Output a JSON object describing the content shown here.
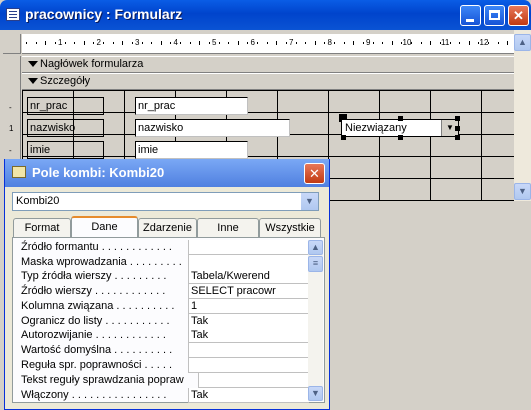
{
  "window": {
    "title": "pracownicy : Formularz"
  },
  "ruler": {
    "numbers": [
      "1",
      "2",
      "3",
      "4",
      "5",
      "6",
      "7",
      "8",
      "9",
      "10",
      "11",
      "12"
    ]
  },
  "sections": {
    "header": "Nagłówek formularza",
    "detail": "Szczegóły"
  },
  "form_fields": [
    {
      "label": "nr_prac",
      "value": "nr_prac"
    },
    {
      "label": "nazwisko",
      "value": "nazwisko"
    },
    {
      "label": "imie",
      "value": "imie"
    }
  ],
  "combo": {
    "value": "Niezwiązany"
  },
  "dialog": {
    "title": "Pole kombi: Kombi20",
    "object_select": "Kombi20",
    "tabs": [
      "Format",
      "Dane",
      "Zdarzenie",
      "Inne",
      "Wszystkie"
    ],
    "active_tab": "Dane",
    "properties": [
      {
        "name": "Źródło formantu . . . . . . . . . . . .",
        "value": ""
      },
      {
        "name": "Maska wprowadzania . . . . . . . . .",
        "value": ""
      },
      {
        "name": "Typ źródła wierszy . . . . . . . . .",
        "value": "Tabela/Kwerend"
      },
      {
        "name": "Źródło wierszy . . . . . . . . . . . .",
        "value": "SELECT pracowr"
      },
      {
        "name": "Kolumna związana . . . . . . . . . .",
        "value": "1"
      },
      {
        "name": "Ogranicz do listy . . . . . . . . . . .",
        "value": "Tak"
      },
      {
        "name": "Autorozwijanie . . . . . . . . . . . .",
        "value": "Tak"
      },
      {
        "name": "Wartość domyślna . . . . . . . . . .",
        "value": ""
      },
      {
        "name": "Reguła spr. poprawności . . . . .",
        "value": ""
      },
      {
        "name": "Tekst reguły sprawdzania popraw",
        "value": ""
      },
      {
        "name": "Włączony . . . . . . . . . . . . . . . .",
        "value": "Tak"
      }
    ]
  },
  "colors": {
    "titlebar": "#0a5de6",
    "dialog_title": "#6a96ec",
    "active_tab_accent": "#e68b2c"
  }
}
